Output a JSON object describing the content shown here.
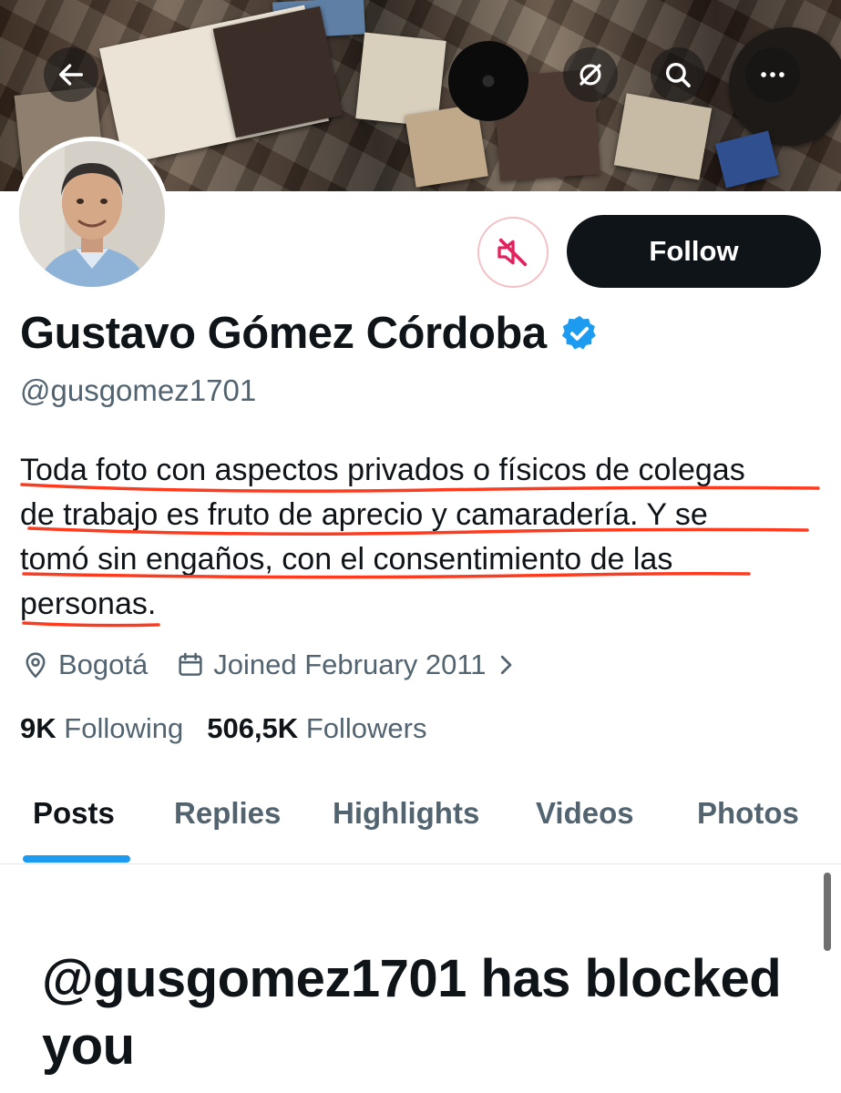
{
  "profile": {
    "display_name": "Gustavo Gómez Córdoba",
    "handle": "@gusgomez1701",
    "bio_lines": [
      "Toda foto con aspectos privados o físicos de colegas",
      "de trabajo es fruto de aprecio y camaradería. Y se",
      "tomó sin engaños, con el consentimiento de las",
      "personas."
    ],
    "location": "Bogotá",
    "joined": "Joined February 2011",
    "following_count": "9K",
    "following_label": "Following",
    "followers_count": "506,5K",
    "followers_label": "Followers"
  },
  "actions": {
    "follow_label": "Follow"
  },
  "tabs": [
    "Posts",
    "Replies",
    "Highlights",
    "Videos",
    "Photos"
  ],
  "active_tab": "Posts",
  "blocked_message": "@gusgomez1701 has blocked you",
  "icons": {
    "back": "arrow-left-icon",
    "grok": "grok-icon",
    "search": "search-icon",
    "more": "more-horizontal-icon",
    "mute": "muted-speaker-icon",
    "verified": "verified-badge-icon",
    "location": "location-pin-icon",
    "calendar": "calendar-icon",
    "chevron": "chevron-right-icon"
  },
  "colors": {
    "verified_blue": "#1d9bf0",
    "follow_bg": "#0f1419",
    "muted_red": "#e0245e",
    "annotation_underline": "#ff3b1f",
    "secondary_text": "#536471"
  }
}
